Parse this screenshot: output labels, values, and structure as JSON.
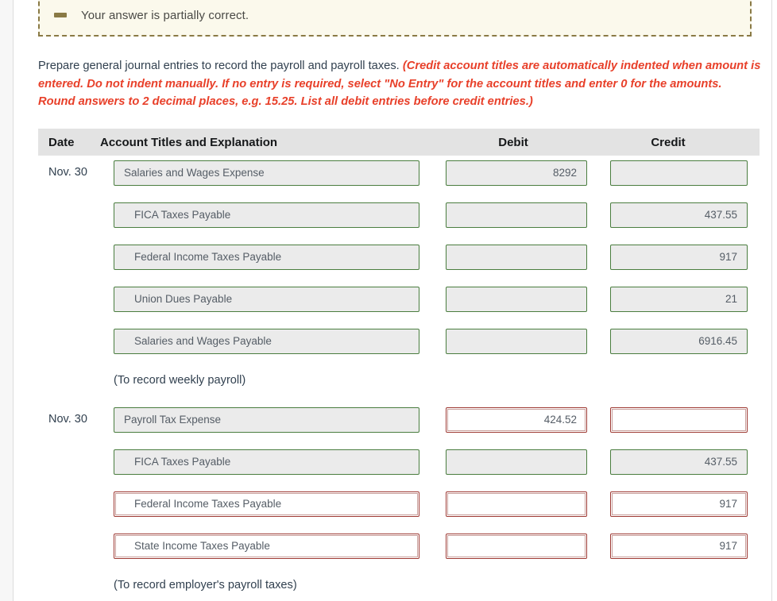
{
  "alert": {
    "icon": "minus-dash-icon",
    "message": "Your answer is partially correct."
  },
  "instructions": {
    "lead": "Prepare general journal entries to record the payroll and payroll taxes.",
    "note": "(Credit account titles are automatically indented when amount is entered. Do not indent manually. If no entry is required, select \"No Entry\" for the account titles and enter 0 for the amounts. Round answers to 2 decimal places, e.g. 15.25. List all debit entries before credit entries.)"
  },
  "table": {
    "headers": {
      "date": "Date",
      "account": "Account Titles and Explanation",
      "debit": "Debit",
      "credit": "Credit"
    },
    "rows": [
      {
        "date": "Nov. 30",
        "account": "Salaries and Wages Expense",
        "account_indent": false,
        "account_state": "ok",
        "debit": "8292",
        "debit_state": "ok",
        "credit": "",
        "credit_state": "ok"
      },
      {
        "date": "",
        "account": "FICA Taxes Payable",
        "account_indent": true,
        "account_state": "ok",
        "debit": "",
        "debit_state": "ok",
        "credit": "437.55",
        "credit_state": "ok"
      },
      {
        "date": "",
        "account": "Federal Income Taxes Payable",
        "account_indent": true,
        "account_state": "ok",
        "debit": "",
        "debit_state": "ok",
        "credit": "917",
        "credit_state": "ok"
      },
      {
        "date": "",
        "account": "Union Dues Payable",
        "account_indent": true,
        "account_state": "ok",
        "debit": "",
        "debit_state": "ok",
        "credit": "21",
        "credit_state": "ok"
      },
      {
        "date": "",
        "account": "Salaries and Wages Payable",
        "account_indent": true,
        "account_state": "ok",
        "debit": "",
        "debit_state": "ok",
        "credit": "6916.45",
        "credit_state": "ok"
      }
    ],
    "memo1": "(To record weekly payroll)",
    "rows2": [
      {
        "date": "Nov. 30",
        "account": "Payroll Tax Expense",
        "account_indent": false,
        "account_state": "ok",
        "debit": "424.52",
        "debit_state": "bad",
        "credit": "",
        "credit_state": "bad"
      },
      {
        "date": "",
        "account": "FICA Taxes Payable",
        "account_indent": true,
        "account_state": "ok",
        "debit": "",
        "debit_state": "ok",
        "credit": "437.55",
        "credit_state": "ok"
      },
      {
        "date": "",
        "account": "Federal Income Taxes Payable",
        "account_indent": true,
        "account_state": "bad",
        "debit": "",
        "debit_state": "bad",
        "credit": "917",
        "credit_state": "bad"
      },
      {
        "date": "",
        "account": "State Income Taxes Payable",
        "account_indent": true,
        "account_state": "bad",
        "debit": "",
        "debit_state": "bad",
        "credit": "917",
        "credit_state": "bad"
      }
    ],
    "memo2": "(To record employer's payroll taxes)"
  },
  "colors": {
    "alert_bg": "#fbf9ec",
    "alert_border": "#8a7a45",
    "instruction_red": "#e8402a",
    "field_ok_border": "#4a7d3f",
    "field_bad_border": "#9e3a34",
    "header_band": "#e3e3e3"
  }
}
